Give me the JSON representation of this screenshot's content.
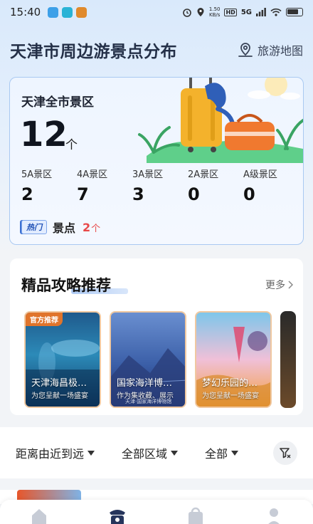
{
  "status_bar": {
    "time": "15:40",
    "net_speed_value": "1.50",
    "net_speed_unit": "KB/s",
    "hd_label": "HD",
    "network_label": "5G"
  },
  "header": {
    "title": "天津市周边游景点分布",
    "map_link_label": "旅游地图"
  },
  "city_card": {
    "title": "天津全市景区",
    "total": "12",
    "total_unit": "个",
    "levels": [
      {
        "label": "5A景区",
        "value": "2"
      },
      {
        "label": "4A景区",
        "value": "7"
      },
      {
        "label": "3A景区",
        "value": "3"
      },
      {
        "label": "2A景区",
        "value": "0"
      },
      {
        "label": "A级景区",
        "value": "0"
      }
    ],
    "hot_badge": "热门",
    "hot_label": "景点",
    "hot_count": "2",
    "hot_unit": "个"
  },
  "guides": {
    "title": "精品攻略推荐",
    "more_label": "更多",
    "official_badge": "官方推荐",
    "items": [
      {
        "name": "天津海昌极地海洋公园",
        "subtitle": "为您呈献一场盛宴"
      },
      {
        "name": "国家海洋博物馆",
        "subtitle": "作为集收藏、展示"
      },
      {
        "name": "梦幻乐园的海洋",
        "subtitle": "为您呈献一场盛宴"
      }
    ],
    "item_watermark": "天津·国家海洋博物馆"
  },
  "filters": {
    "distance": "距离由近到远",
    "region": "全部区域",
    "category": "全部"
  },
  "colors": {
    "accent_blue": "#2f6fd6",
    "hot_red": "#e84848",
    "title_navy": "#243048"
  },
  "nav": {
    "tabs": [
      "home-icon",
      "guide-icon",
      "shop-icon",
      "profile-icon"
    ]
  }
}
